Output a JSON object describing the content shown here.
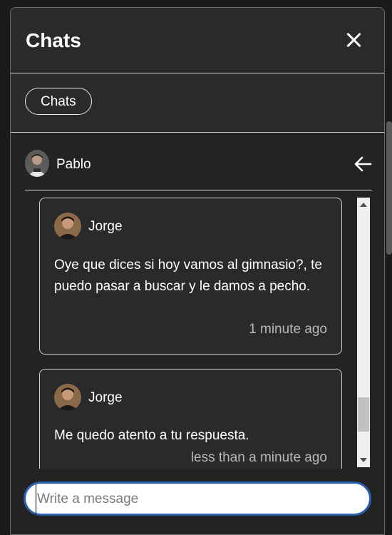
{
  "header": {
    "title": "Chats"
  },
  "tabs": [
    {
      "label": "Chats"
    }
  ],
  "conversation": {
    "contact_name": "Pablo"
  },
  "messages": [
    {
      "sender": "Jorge",
      "text": "Oye que dices si hoy vamos al gimnasio?, te puedo pasar a buscar y le damos a pecho.",
      "time": "1 minute ago"
    },
    {
      "sender": "Jorge",
      "text": "Me quedo atento a tu respuesta.",
      "time": "less than a minute ago"
    }
  ],
  "composer": {
    "placeholder": "Write a message",
    "value": ""
  },
  "icons": {
    "close": "close-icon",
    "back": "arrow-left-icon",
    "avatar": "user-avatar"
  },
  "colors": {
    "panel_bg": "#2a2a2a",
    "page_bg": "#1b1b1b",
    "input_border": "#2a5fb0",
    "timestamp": "#b9b9b9"
  }
}
